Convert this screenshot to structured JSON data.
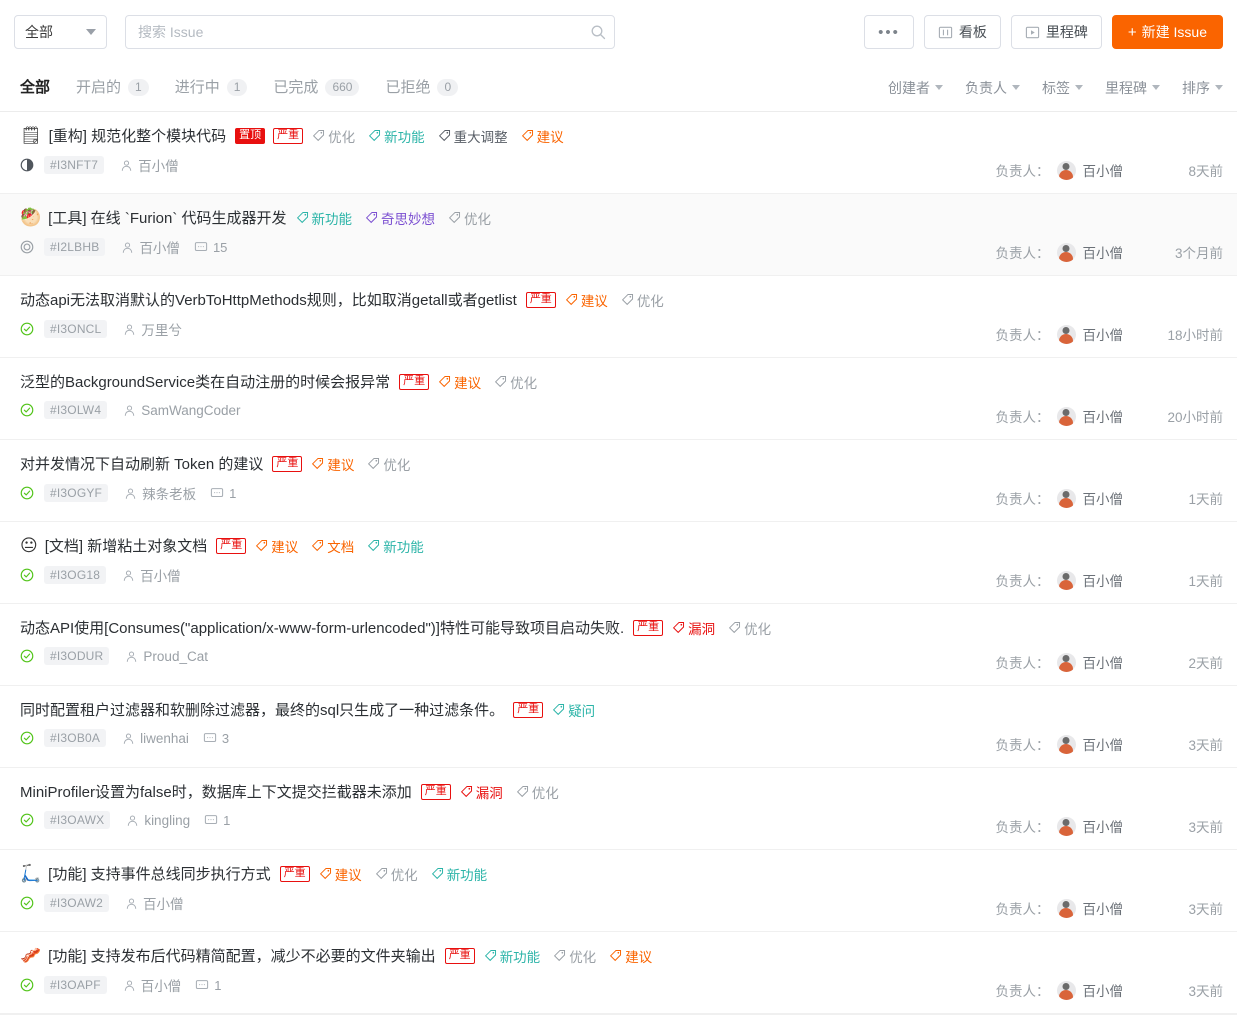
{
  "toolbar": {
    "filter_select": {
      "value": "全部",
      "icon": "chevron-down-icon"
    },
    "search": {
      "placeholder": "搜索 Issue",
      "value": "",
      "icon": "search-icon"
    },
    "more_label": "•••",
    "board_label": "看板",
    "milestone_label": "里程碑",
    "new_issue_label": "新建 Issue",
    "new_issue_plus": "+",
    "accent_color": "#fa6400"
  },
  "filterbar": {
    "tabs": [
      {
        "label": "全部",
        "count": "",
        "active": true
      },
      {
        "label": "开启的",
        "count": "1",
        "active": false
      },
      {
        "label": "进行中",
        "count": "1",
        "active": false
      },
      {
        "label": "已完成",
        "count": "660",
        "active": false
      },
      {
        "label": "已拒绝",
        "count": "0",
        "active": false
      }
    ],
    "dropdowns": [
      {
        "label": "创建者"
      },
      {
        "label": "负责人"
      },
      {
        "label": "标签"
      },
      {
        "label": "里程碑"
      },
      {
        "label": "排序"
      }
    ]
  },
  "labels": {
    "assignee_prefix": "负责人：",
    "pinned": "置顶",
    "severe": "严重"
  },
  "tag_colors": {
    "优化": "#9aa0a6",
    "新功能": "#2bb4a8",
    "重大调整": "#585e66",
    "建议": "#fa6400",
    "奇思妙想": "#7b4fd1",
    "文档": "#fa6400",
    "漏洞": "#e8100f",
    "疑问": "#2bb4a8"
  },
  "issues": [
    {
      "emoji": "🗒",
      "emoji_name": "note-emoji",
      "title": "[重构] 规范化整个模块代码",
      "pinned": true,
      "severe": true,
      "tags": [
        "优化",
        "新功能",
        "重大调整",
        "建议"
      ],
      "status": "progress",
      "number": "#I3NFT7",
      "author": "百小僧",
      "comments": "",
      "assignee": "百小僧",
      "time": "8天前",
      "shaded": false
    },
    {
      "emoji": "🥙",
      "emoji_name": "stuffed-flatbread-emoji",
      "title": "[工具] 在线 `Furion` 代码生成器开发",
      "pinned": false,
      "severe": false,
      "tags": [
        "新功能",
        "奇思妙想",
        "优化"
      ],
      "status": "open",
      "number": "#I2LBHB",
      "author": "百小僧",
      "comments": "15",
      "assignee": "百小僧",
      "time": "3个月前",
      "shaded": true
    },
    {
      "emoji": "",
      "emoji_name": "",
      "title": "动态api无法取消默认的VerbToHttpMethods规则，比如取消getall或者getlist",
      "pinned": false,
      "severe": true,
      "tags": [
        "建议",
        "优化"
      ],
      "status": "done",
      "number": "#I3ONCL",
      "author": "万里兮",
      "comments": "",
      "assignee": "百小僧",
      "time": "18小时前",
      "shaded": false
    },
    {
      "emoji": "",
      "emoji_name": "",
      "title": "泛型的BackgroundService类在自动注册的时候会报异常",
      "pinned": false,
      "severe": true,
      "tags": [
        "建议",
        "优化"
      ],
      "status": "done",
      "number": "#I3OLW4",
      "author": "SamWangCoder",
      "comments": "",
      "assignee": "百小僧",
      "time": "20小时前",
      "shaded": false
    },
    {
      "emoji": "",
      "emoji_name": "",
      "title": "对并发情况下自动刷新 Token 的建议",
      "pinned": false,
      "severe": true,
      "tags": [
        "建议",
        "优化"
      ],
      "status": "done",
      "number": "#I3OGYF",
      "author": "辣条老板",
      "comments": "1",
      "assignee": "百小僧",
      "time": "1天前",
      "shaded": false
    },
    {
      "emoji": "😐",
      "emoji_name": "neutral-face-emoji",
      "title": "[文档] 新增粘土对象文档",
      "pinned": false,
      "severe": true,
      "tags": [
        "建议",
        "文档",
        "新功能"
      ],
      "status": "done",
      "number": "#I3OG18",
      "author": "百小僧",
      "comments": "",
      "assignee": "百小僧",
      "time": "1天前",
      "shaded": false
    },
    {
      "emoji": "",
      "emoji_name": "",
      "title": "动态API使用[Consumes(\"application/x-www-form-urlencoded\")]特性可能导致项目启动失败.",
      "pinned": false,
      "severe": true,
      "tags": [
        "漏洞",
        "优化"
      ],
      "status": "done",
      "number": "#I3ODUR",
      "author": "Proud_Cat",
      "comments": "",
      "assignee": "百小僧",
      "time": "2天前",
      "shaded": false
    },
    {
      "emoji": "",
      "emoji_name": "",
      "title": "同时配置租户过滤器和软删除过滤器，最终的sql只生成了一种过滤条件。",
      "pinned": false,
      "severe": true,
      "tags": [
        "疑问"
      ],
      "status": "done",
      "number": "#I3OB0A",
      "author": "liwenhai",
      "comments": "3",
      "assignee": "百小僧",
      "time": "3天前",
      "shaded": false
    },
    {
      "emoji": "",
      "emoji_name": "",
      "title": "MiniProfiler设置为false时，数据库上下文提交拦截器未添加",
      "pinned": false,
      "severe": true,
      "tags": [
        "漏洞",
        "优化"
      ],
      "status": "done",
      "number": "#I3OAWX",
      "author": "kingling",
      "comments": "1",
      "assignee": "百小僧",
      "time": "3天前",
      "shaded": false
    },
    {
      "emoji": "🛴",
      "emoji_name": "scooter-emoji",
      "title": "[功能] 支持事件总线同步执行方式",
      "pinned": false,
      "severe": true,
      "tags": [
        "建议",
        "优化",
        "新功能"
      ],
      "status": "done",
      "number": "#I3OAW2",
      "author": "百小僧",
      "comments": "",
      "assignee": "百小僧",
      "time": "3天前",
      "shaded": false
    },
    {
      "emoji": "🥓",
      "emoji_name": "bacon-emoji",
      "title": "[功能] 支持发布后代码精简配置，减少不必要的文件夹输出",
      "pinned": false,
      "severe": true,
      "tags": [
        "新功能",
        "优化",
        "建议"
      ],
      "status": "done",
      "number": "#I3OAPF",
      "author": "百小僧",
      "comments": "1",
      "assignee": "百小僧",
      "time": "3天前",
      "shaded": false
    }
  ]
}
